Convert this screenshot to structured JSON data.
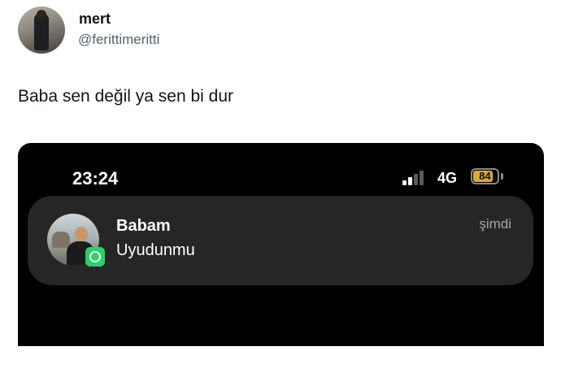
{
  "tweet": {
    "author_name": "mert",
    "author_handle": "@ferittimeritti",
    "text": "Baba sen değil ya sen bi dur"
  },
  "screenshot": {
    "status_bar": {
      "time": "23:24",
      "network": "4G",
      "battery": "84",
      "signal_bars_active": 2,
      "signal_bars_total": 4,
      "battery_level": 0.84,
      "battery_icon": "charging-battery-icon"
    },
    "notification": {
      "sender": "Babam",
      "message": "Uyudunmu",
      "time": "şimdi",
      "app_icon": "whatsapp-icon"
    }
  },
  "colors": {
    "whatsapp_green": "#25d366",
    "battery_fill": "#d9a93a"
  }
}
